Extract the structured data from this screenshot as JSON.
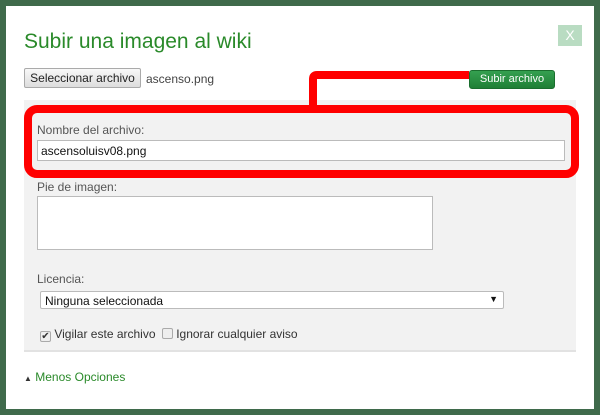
{
  "dialog": {
    "title": "Subir una imagen al wiki",
    "close_label": "X"
  },
  "file": {
    "select_button": "Seleccionar archivo",
    "selected_file": "ascenso.png",
    "upload_button": "Subir archivo"
  },
  "form": {
    "filename_label": "Nombre del archivo:",
    "filename_value": "ascensoluisv08.png",
    "caption_label": "Pie de imagen:",
    "caption_value": "",
    "license_label": "Licencia:",
    "license_value": "Ninguna seleccionada",
    "watch_label": "Vigilar este archivo",
    "watch_checked": true,
    "ignore_label": "Ignorar cualquier aviso",
    "ignore_checked": false
  },
  "less_options": "Menos Opciones",
  "annotation_color": "#ff0000"
}
